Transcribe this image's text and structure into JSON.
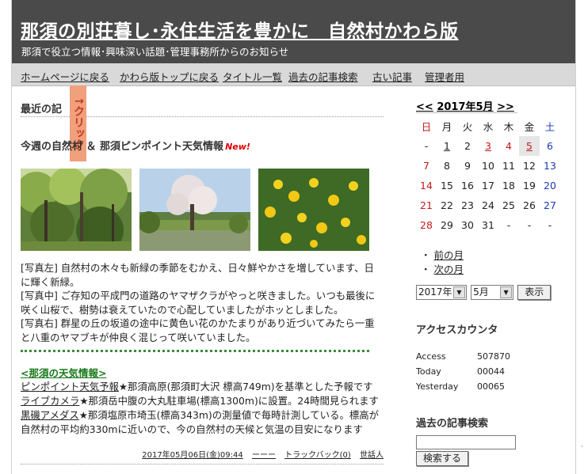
{
  "header": {
    "title": "那須の別荘暮し･永住生活を豊かに　自然村かわら版",
    "description": "那須で役立つ情報･興味深い話題･管理事務所からのお知らせ"
  },
  "nav": {
    "items": [
      "ホームページに戻る",
      "かわら版トップに戻る",
      "タイトル一覧",
      "過去の記事検索",
      "古い記事",
      "管理者用"
    ]
  },
  "main": {
    "recent_heading": "最近の記",
    "overlay_label": "↑クリック",
    "post_title": "今週の自然村 ＆ 那須ピンポイント天気情報",
    "new_badge": "New!",
    "photos": [
      {
        "name": "forest-photo",
        "alt": "新緑の木々"
      },
      {
        "name": "cherry-tree-photo",
        "alt": "山桜"
      },
      {
        "name": "yellow-flowers-photo",
        "alt": "ヤマブキ"
      }
    ],
    "paragraphs": [
      "[写真左] 自然村の木々も新緑の季節をむかえ、日々鮮やかさを増しています、日に輝く新緑。",
      "[写真中] ご存知の平成門の道路のヤマザクラがやっと咲きました。いつも最後に咲く山桜で、樹勢は衰えていたので心配していましたがホッとしました。",
      "[写真右] 群星の丘の坂道の途中に黄色い花のかたまりがあり近づいてみたら一重と八重のヤマブキが仲良く混じって咲いていました。"
    ],
    "weather_heading": "<那須の天気情報>",
    "weather_lines": [
      {
        "link": "ピンポイント天気予報",
        "text": "★那須高原(那須町大沢 標高749m)を基準とした予報です"
      },
      {
        "link": "ライブカメラ",
        "text": "★那須岳中腹の大丸駐車場(標高1300m)に設置。24時間見られます"
      },
      {
        "link": "黒磯アメダス",
        "text": "★那須塩原市埼玉(標高343m)の測量値で毎時計測している。標高が自然村の平均約330mに近いので、今の自然村の天候と気温の目安になります"
      }
    ],
    "footer": {
      "date": "2017年05月06日(金)09:44",
      "author": "ーーー",
      "trackback": "トラックバック(0)",
      "category": "世話人"
    }
  },
  "calendar": {
    "title": "2017年5月",
    "prev_arrow": "<<",
    "next_arrow": ">>",
    "weekdays": [
      "日",
      "月",
      "火",
      "水",
      "木",
      "金",
      "土"
    ],
    "weeks": [
      [
        "-",
        "1",
        "2",
        "3",
        "4",
        "5",
        "6"
      ],
      [
        "7",
        "8",
        "9",
        "10",
        "11",
        "12",
        "13"
      ],
      [
        "14",
        "15",
        "16",
        "17",
        "18",
        "19",
        "20"
      ],
      [
        "21",
        "22",
        "23",
        "24",
        "25",
        "26",
        "27"
      ],
      [
        "28",
        "29",
        "30",
        "31",
        "-",
        "-",
        "-"
      ]
    ],
    "linked_days": [
      "1",
      "3",
      "5"
    ],
    "holiday_days": [
      "3",
      "4",
      "5"
    ],
    "today": "5",
    "prev_month": "前の月",
    "next_month": "次の月",
    "year_select": "2017年",
    "month_select": "5月",
    "show_button": "表示"
  },
  "counter": {
    "heading": "アクセスカウンタ",
    "rows": [
      {
        "label": "Access",
        "value": "507870"
      },
      {
        "label": "Today",
        "value": "00044"
      },
      {
        "label": "Yesterday",
        "value": "00065"
      }
    ]
  },
  "search": {
    "heading": "過去の記事検索",
    "input_value": "",
    "button": "検索する"
  },
  "colors": {
    "header_bg": "#4a4a4a",
    "nav_bg": "#d9d9d9",
    "sunday": "#c41a1a",
    "saturday": "#1a3ab4",
    "weather_green": "#1a7a1a",
    "new_red": "#e00000",
    "overlay": "#f0a07a"
  }
}
